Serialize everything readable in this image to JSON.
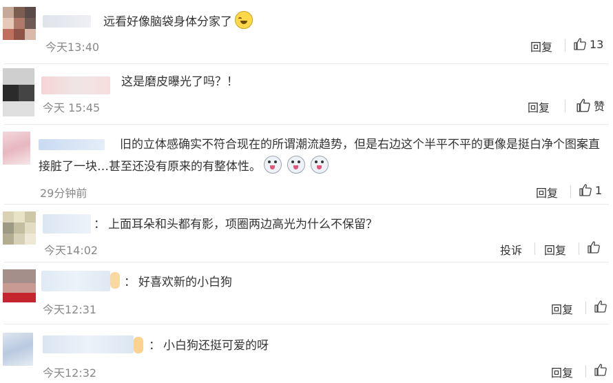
{
  "comments": [
    {
      "text": "远看好像脑袋身体分家了",
      "time": "今天13:40",
      "reply": "回复",
      "likes": "13",
      "emoji": "cry-laugh-emoji"
    },
    {
      "text": "这是磨皮曝光了吗？！",
      "time": "今天 15:45",
      "reply": "回复",
      "likes": "赞"
    },
    {
      "line1": "旧的立体感确实不符合现在的所谓潮流趋势，但是右边这个半平不平的更像是挺白净个图案直",
      "line2": "接脏了一块…甚至还没有原来的有整体性。",
      "time": "29分钟前",
      "reply": "回复",
      "likes": "1",
      "emoji": "dog-face-emoji"
    },
    {
      "text": "上面耳朵和头都有影，项圈两边高光为什么不保留？",
      "time": "今天14:02",
      "report": "投诉",
      "reply": "回复",
      "likes": ""
    },
    {
      "text": "好喜欢新的小白狗",
      "time": "今天12:31",
      "reply": "回复",
      "likes": ""
    },
    {
      "text": "小白狗还挺可爱的呀",
      "time": "今天12:32",
      "reply": "回复",
      "likes": ""
    }
  ],
  "colon": "：",
  "icons": {
    "thumb": "thumbs-up-icon"
  }
}
